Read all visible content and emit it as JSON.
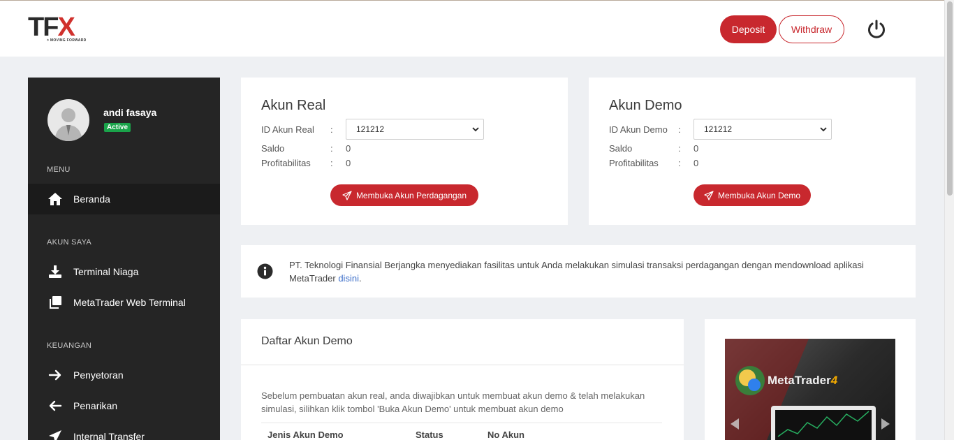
{
  "header": {
    "logo_text_tf": "TF",
    "logo_text_x": "X",
    "logo_tagline": "> MOVING FORWARD",
    "deposit_label": "Deposit",
    "withdraw_label": "Withdraw",
    "power_icon": "power-icon"
  },
  "sidebar": {
    "user_name": "andi fasaya",
    "user_status": "Active",
    "sections": {
      "menu": "MENU",
      "akun_saya": "AKUN SAYA",
      "keuangan": "KEUANGAN"
    },
    "items": [
      {
        "label": "Beranda",
        "icon": "home-icon"
      },
      {
        "label": "Terminal Niaga",
        "icon": "download-icon"
      },
      {
        "label": "MetaTrader Web Terminal",
        "icon": "copy-icon"
      },
      {
        "label": "Penyetoran",
        "icon": "arrow-right-icon"
      },
      {
        "label": "Penarikan",
        "icon": "arrow-left-icon"
      },
      {
        "label": "Internal Transfer",
        "icon": "send-icon"
      }
    ]
  },
  "real_account": {
    "title": "Akun Real",
    "id_label": "ID Akun Real",
    "id_value": "121212",
    "saldo_label": "Saldo",
    "saldo_value": "0",
    "profit_label": "Profitabilitas",
    "profit_value": "0",
    "button_label": "Membuka Akun Perdagangan"
  },
  "demo_account": {
    "title": "Akun Demo",
    "id_label": "ID Akun Demo",
    "id_value": "121212",
    "saldo_label": "Saldo",
    "saldo_value": "0",
    "profit_label": "Profitabilitas",
    "profit_value": "0",
    "button_label": "Membuka Akun Demo"
  },
  "separator": ":",
  "info": {
    "text": "PT. Teknologi Finansial Berjangka menyediakan fasilitas untuk Anda melakukan simulasi transaksi perdagangan dengan mendownload aplikasi MetaTrader ",
    "link": "disini",
    "end": "."
  },
  "demo_list": {
    "title": "Daftar Akun Demo",
    "description": "Sebelum pembuatan akun real, anda diwajibkan untuk membuat akun demo & telah melakukan simulasi, silihkan klik tombol 'Buka Akun Demo' untuk membuat akun demo",
    "columns": [
      "Jenis Akun Demo",
      "Status",
      "No Akun"
    ]
  },
  "banner": {
    "brand": "MetaTrader",
    "version": "4"
  },
  "colors": {
    "accent": "#c8282e",
    "sidebar_bg": "#252525",
    "badge": "#1aa34a",
    "link": "#3c6ec9"
  }
}
